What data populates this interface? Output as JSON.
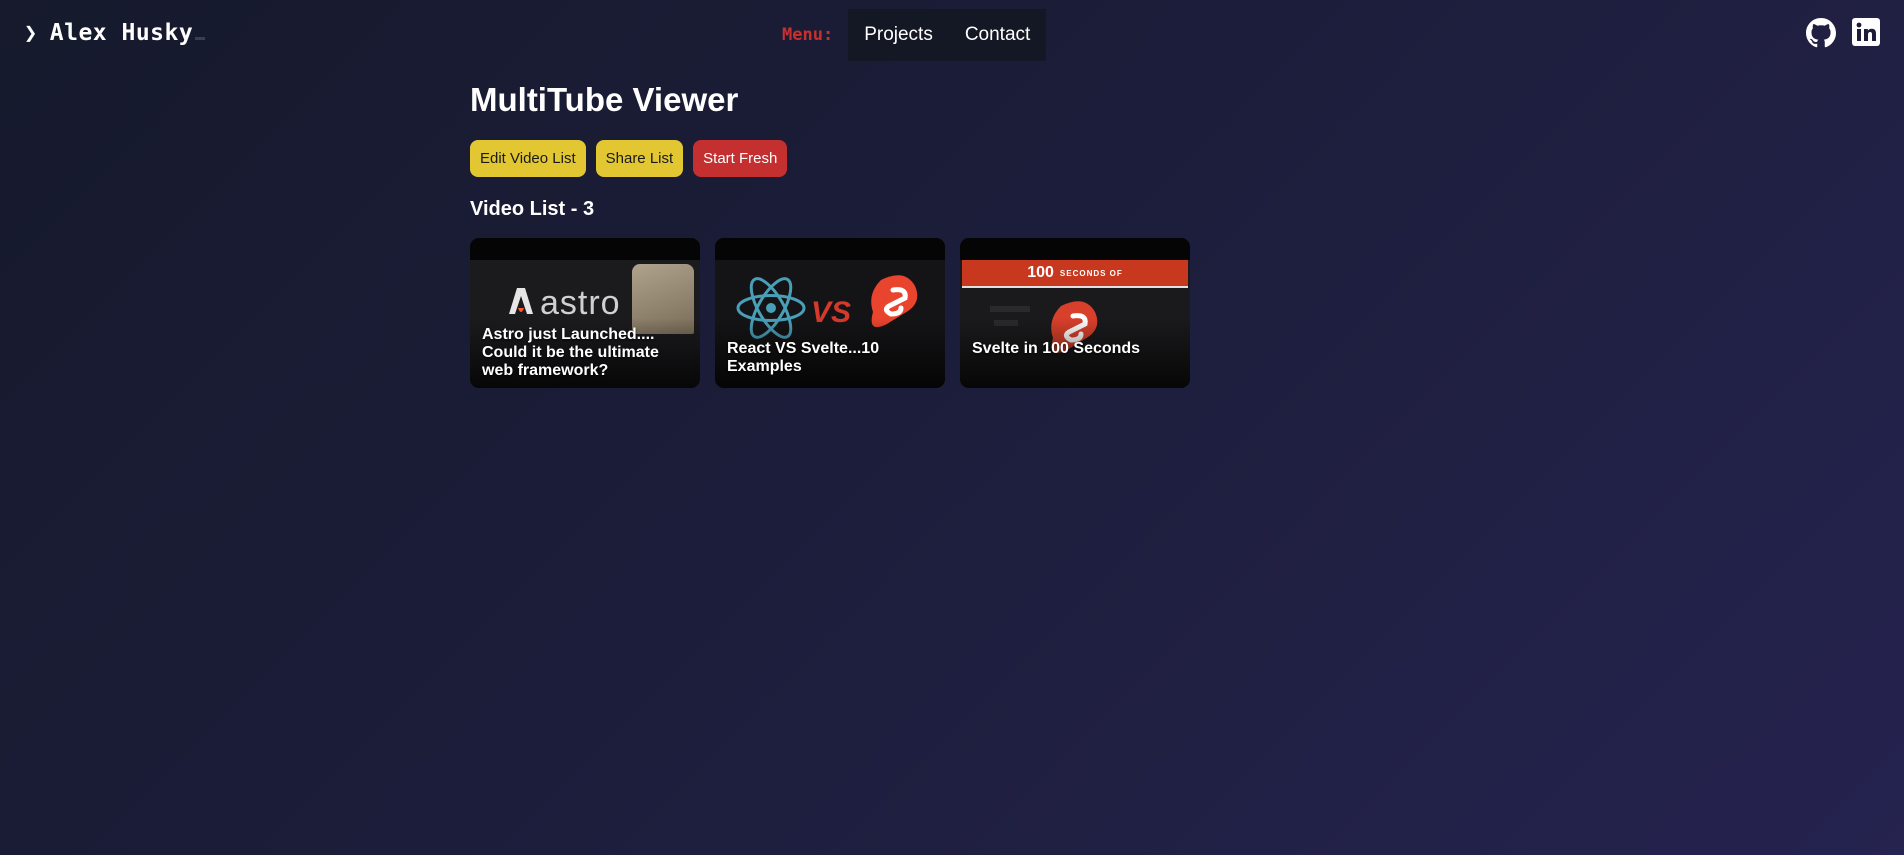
{
  "header": {
    "logo_chevron": "❯",
    "logo_text": "Alex Husky",
    "menu_label": "Menu:",
    "nav": [
      {
        "label": "Projects"
      },
      {
        "label": "Contact"
      }
    ],
    "social_icons": [
      "github-icon",
      "linkedin-icon"
    ]
  },
  "main": {
    "title": "MultiTube Viewer",
    "buttons": {
      "edit": "Edit Video List",
      "share": "Share List",
      "start_fresh": "Start Fresh"
    },
    "list_heading": "Video List - 3",
    "videos": [
      {
        "title": "Astro just Launched.... Could it be the ultimate web framework?",
        "thumb_text": "astro"
      },
      {
        "title": "React VS Svelte...10 Examples",
        "thumb_text": "VS"
      },
      {
        "title": "Svelte in 100 Seconds",
        "thumb_text": "100",
        "thumb_subtext": "SECONDS OF"
      }
    ]
  },
  "colors": {
    "accent_yellow": "#e2c733",
    "accent_red": "#c42f2f",
    "menu_label": "#c8302f",
    "background_start": "#161a2c",
    "background_end": "#25234f"
  }
}
